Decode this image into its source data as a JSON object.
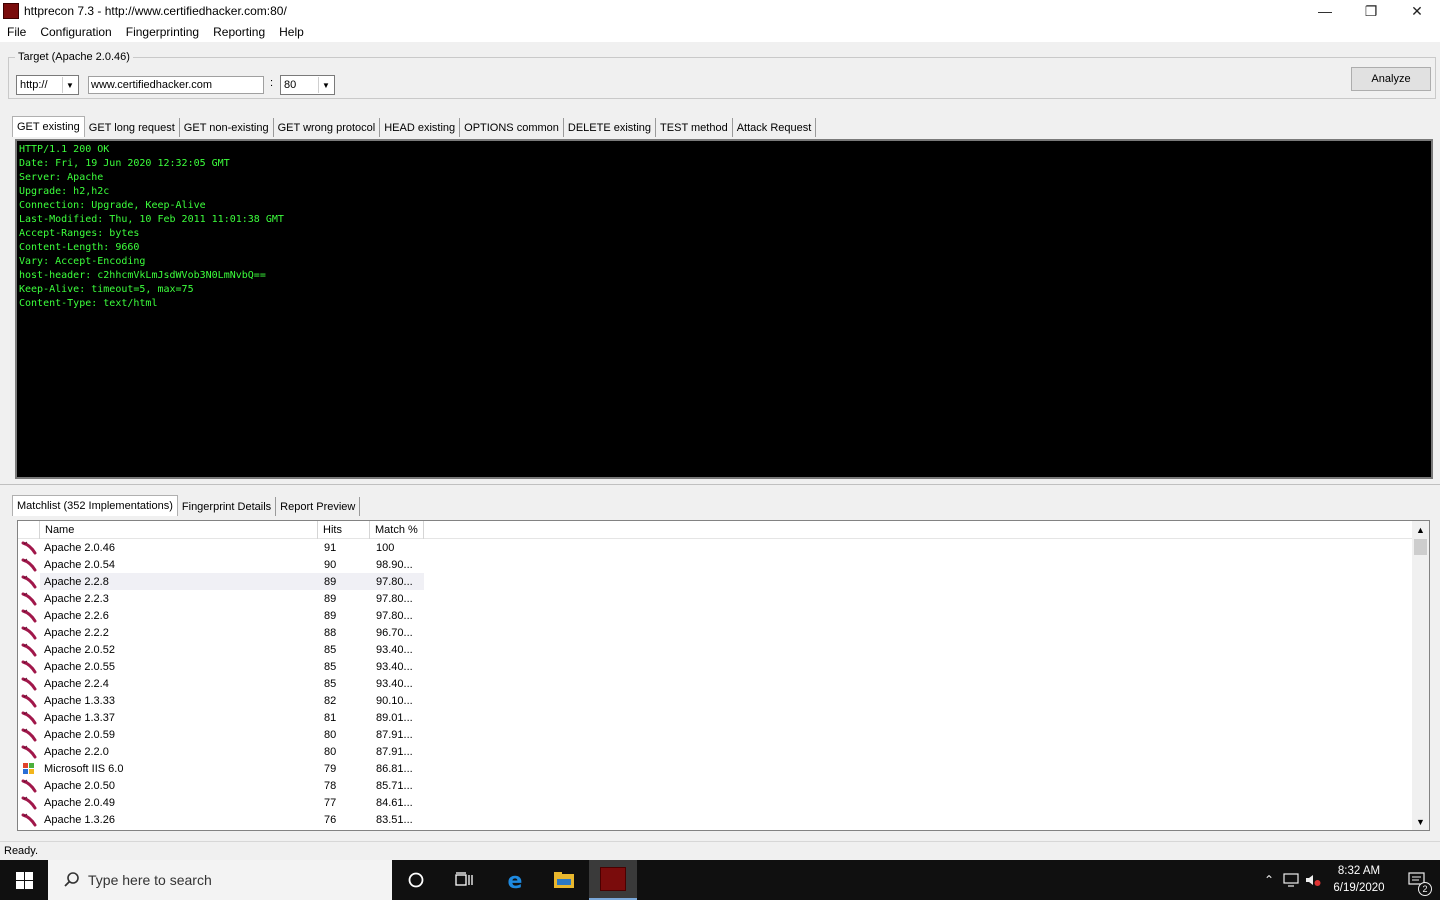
{
  "window": {
    "title": "httprecon 7.3 - http://www.certifiedhacker.com:80/",
    "minimize": "—",
    "restore": "❐",
    "close": "✕"
  },
  "menu": [
    "File",
    "Configuration",
    "Fingerprinting",
    "Reporting",
    "Help"
  ],
  "target": {
    "legend": "Target (Apache 2.0.46)",
    "protocol": "http://",
    "host": "www.certifiedhacker.com",
    "colon": ":",
    "port": "80",
    "analyze_label": "Analyze"
  },
  "request_tabs": [
    "GET existing",
    "GET long request",
    "GET non-existing",
    "GET wrong protocol",
    "HEAD existing",
    "OPTIONS common",
    "DELETE existing",
    "TEST method",
    "Attack Request"
  ],
  "response_lines": [
    "HTTP/1.1 200 OK",
    "Date: Fri, 19 Jun 2020 12:32:05 GMT",
    "Server: Apache",
    "Upgrade: h2,h2c",
    "Connection: Upgrade, Keep-Alive",
    "Last-Modified: Thu, 10 Feb 2011 11:01:38 GMT",
    "Accept-Ranges: bytes",
    "Content-Length: 9660",
    "Vary: Accept-Encoding",
    "host-header: c2hhcmVkLmJsdWVob3N0LmNvbQ==",
    "Keep-Alive: timeout=5, max=75",
    "Content-Type: text/html"
  ],
  "result_tabs": [
    "Matchlist (352 Implementations)",
    "Fingerprint Details",
    "Report Preview"
  ],
  "matchlist": {
    "columns": [
      "Name",
      "Hits",
      "Match %"
    ],
    "rows": [
      {
        "icon": "apache-feather-icon",
        "name": "Apache 2.0.46",
        "hits": "91",
        "match": "100"
      },
      {
        "icon": "apache-feather-icon",
        "name": "Apache 2.0.54",
        "hits": "90",
        "match": "98.90..."
      },
      {
        "icon": "apache-feather-icon",
        "name": "Apache 2.2.8",
        "hits": "89",
        "match": "97.80..."
      },
      {
        "icon": "apache-feather-icon",
        "name": "Apache 2.2.3",
        "hits": "89",
        "match": "97.80..."
      },
      {
        "icon": "apache-feather-icon",
        "name": "Apache 2.2.6",
        "hits": "89",
        "match": "97.80..."
      },
      {
        "icon": "apache-feather-icon",
        "name": "Apache 2.2.2",
        "hits": "88",
        "match": "96.70..."
      },
      {
        "icon": "apache-feather-icon",
        "name": "Apache 2.0.52",
        "hits": "85",
        "match": "93.40..."
      },
      {
        "icon": "apache-feather-icon",
        "name": "Apache 2.0.55",
        "hits": "85",
        "match": "93.40..."
      },
      {
        "icon": "apache-feather-icon",
        "name": "Apache 2.2.4",
        "hits": "85",
        "match": "93.40..."
      },
      {
        "icon": "apache-feather-icon",
        "name": "Apache 1.3.33",
        "hits": "82",
        "match": "90.10..."
      },
      {
        "icon": "apache-feather-icon",
        "name": "Apache 1.3.37",
        "hits": "81",
        "match": "89.01..."
      },
      {
        "icon": "apache-feather-icon",
        "name": "Apache 2.0.59",
        "hits": "80",
        "match": "87.91..."
      },
      {
        "icon": "apache-feather-icon",
        "name": "Apache 2.2.0",
        "hits": "80",
        "match": "87.91..."
      },
      {
        "icon": "windows-flag-icon",
        "name": "Microsoft IIS 6.0",
        "hits": "79",
        "match": "86.81..."
      },
      {
        "icon": "apache-feather-icon",
        "name": "Apache 2.0.50",
        "hits": "78",
        "match": "85.71..."
      },
      {
        "icon": "apache-feather-icon",
        "name": "Apache 2.0.49",
        "hits": "77",
        "match": "84.61..."
      },
      {
        "icon": "apache-feather-icon",
        "name": "Apache 1.3.26",
        "hits": "76",
        "match": "83.51..."
      }
    ]
  },
  "status": "Ready.",
  "taskbar": {
    "search_placeholder": "Type here to search",
    "time": "8:32 AM",
    "date": "6/19/2020",
    "notifications": "2"
  },
  "colors": {
    "console_bg": "#000000",
    "console_text": "#3cff3c",
    "taskbar_bg": "#101010",
    "apache_feather": "#a0174a"
  }
}
